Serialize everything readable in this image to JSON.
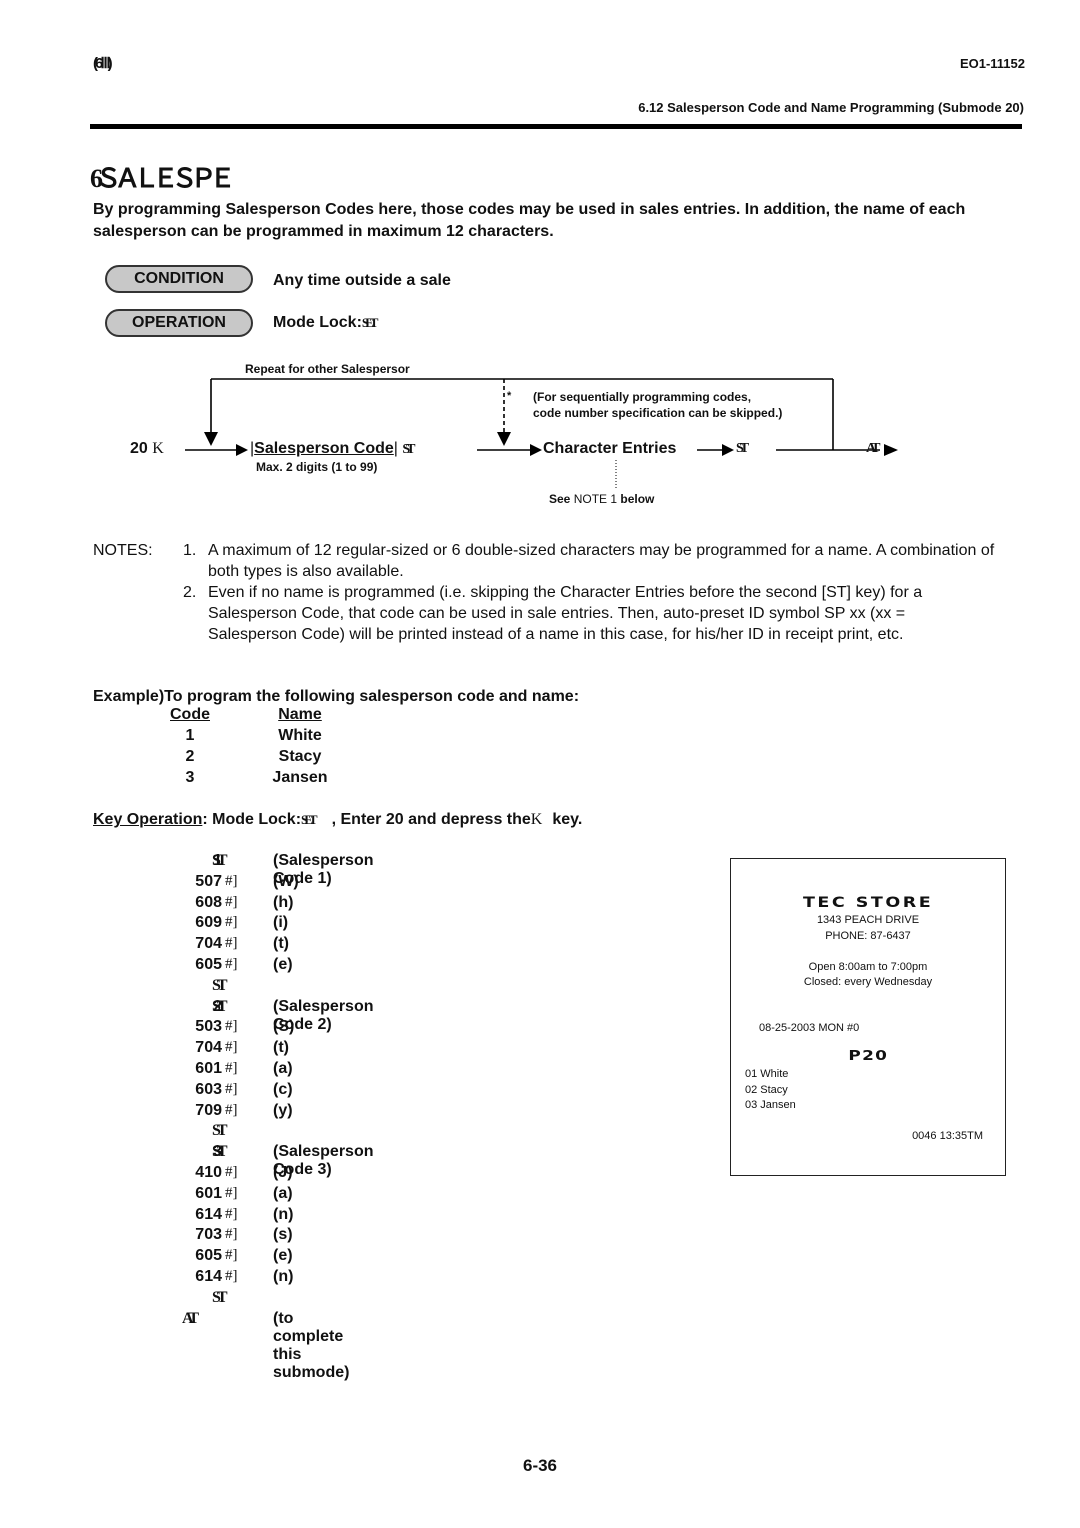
{
  "header": {
    "left_glyph": "(6Ⅲ)",
    "doc_number": "EO1-11152",
    "section": "6.12 Salesperson Code and Name Programming (Submode 20)"
  },
  "title": "6.12 Salesperson Code and Name Programming (Submode 20)",
  "title_garbled": "6  ＳＡＬＥＳＰＥ",
  "intro": "By programming Salesperson Codes here, those codes may be used in sales entries.  In addition, the name of each salesperson can be programmed in maximum 12 characters.",
  "condition": {
    "label": "CONDITION",
    "text": "Any time outside a sale"
  },
  "operation": {
    "label": "OPERATION",
    "text": "Mode Lock:",
    "key_glyph": "SET"
  },
  "diagram": {
    "repeat_label": "Repeat for other Salespersor",
    "skip_note_line1": "(For  sequentially  programming  codes,",
    "skip_note_line2": "code number specification can be skipped.)",
    "star": "*",
    "start_value": "20",
    "start_key": "K",
    "salesperson_code": "Salesperson Code",
    "st_key": "ST",
    "code_hint": "Max. 2 digits (1 to 99)",
    "character_entries": "Character Entries",
    "see_note_prefix": "See",
    "see_note_ref": "NOTE 1",
    "see_note_suffix": "below",
    "end_key": "AT"
  },
  "notes": {
    "label": "NOTES:",
    "items": [
      {
        "num": "1.",
        "text": "A maximum of 12 regular-sized or 6 double-sized characters may be programmed for a name. A combination of both types is also available."
      },
      {
        "num": "2.",
        "text": "Even if no name is programmed (i.e. skipping the Character Entries before the second [ST] key) for a Salesperson Code, that code can be used in sale entries. Then, auto-preset ID symbol  SP xx  (xx = Salesperson Code) will be printed instead of a name in this case, for his/her ID in receipt print, etc."
      }
    ]
  },
  "example": {
    "heading": "Example)To program the following salesperson code and name:",
    "columns": [
      "Code",
      "Name"
    ],
    "rows": [
      [
        "1",
        "White"
      ],
      [
        "2",
        "Stacy"
      ],
      [
        "3",
        "Jansen"
      ]
    ]
  },
  "key_operation": {
    "label": "Key Operation",
    "text1": ": Mode Lock:",
    "mode_glyph": "SET",
    "text2": ", Enter 20 and depress the",
    "key_glyph": "K",
    "text3": "key."
  },
  "steps": [
    {
      "key": "1",
      "type": "st",
      "desc": "(Salesperson Code 1)"
    },
    {
      "key": "507",
      "type": "char",
      "desc": "(W)"
    },
    {
      "key": "608",
      "type": "char",
      "desc": "(h)"
    },
    {
      "key": "609",
      "type": "char",
      "desc": "(i)"
    },
    {
      "key": "704",
      "type": "char",
      "desc": "(t)"
    },
    {
      "key": "605",
      "type": "char",
      "desc": "(e)"
    },
    {
      "key": "",
      "type": "st",
      "desc": ""
    },
    {
      "key": "2",
      "type": "st",
      "desc": "(Salesperson Code 2)"
    },
    {
      "key": "503",
      "type": "char",
      "desc": "(S)"
    },
    {
      "key": "704",
      "type": "char",
      "desc": "(t)"
    },
    {
      "key": "601",
      "type": "char",
      "desc": "(a)"
    },
    {
      "key": "603",
      "type": "char",
      "desc": "(c)"
    },
    {
      "key": "709",
      "type": "char",
      "desc": "(y)"
    },
    {
      "key": "",
      "type": "st",
      "desc": ""
    },
    {
      "key": "3",
      "type": "st",
      "desc": "(Salesperson Code 3)"
    },
    {
      "key": "410",
      "type": "char",
      "desc": "(J)"
    },
    {
      "key": "601",
      "type": "char",
      "desc": "(a)"
    },
    {
      "key": "614",
      "type": "char",
      "desc": "(n)"
    },
    {
      "key": "703",
      "type": "char",
      "desc": "(s)"
    },
    {
      "key": "605",
      "type": "char",
      "desc": "(e)"
    },
    {
      "key": "614",
      "type": "char",
      "desc": "(n)"
    },
    {
      "key": "",
      "type": "st",
      "desc": ""
    },
    {
      "key": "",
      "type": "at",
      "desc": "(to complete this submode)"
    }
  ],
  "glyphs": {
    "st": "ST",
    "char": "#]",
    "at": "AT"
  },
  "receipt": {
    "store_name": "TEC STORE",
    "address": "1343 PEACH DRIVE",
    "phone": "PHONE: 87-6437",
    "hours": "Open  8:00am to 7:00pm",
    "closed": "Closed: every Wednesday",
    "date_line": "08-25-2003 MON  #0",
    "report_title": "P20",
    "entries": [
      "01 White",
      "02 Stacy",
      "03 Jansen"
    ],
    "footer": "0046 13:35TM"
  },
  "page_number": "6-36"
}
